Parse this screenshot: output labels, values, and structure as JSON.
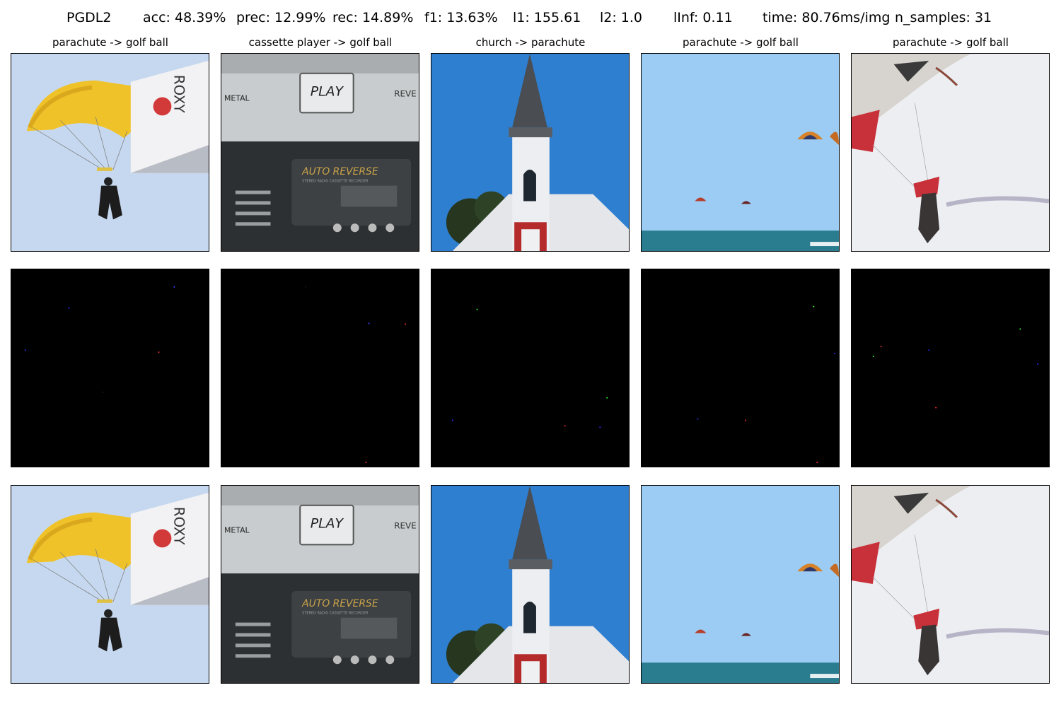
{
  "metrics": {
    "method": "PGDL2",
    "acc": "acc: 48.39%",
    "prec": "prec: 12.99%",
    "rec": "rec: 14.89%",
    "f1": "f1: 13.63%",
    "l1": "l1: 155.61",
    "l2": "l2: 1.0",
    "linf": "lInf: 0.11",
    "time": "time: 80.76ms/img",
    "n_samples": "n_samples: 31"
  },
  "columns": [
    {
      "title": "parachute -> golf ball",
      "scene": "skydiver-yellow-parachute"
    },
    {
      "title": "cassette player -> golf ball",
      "scene": "cassette-player-play-button"
    },
    {
      "title": "church -> parachute",
      "scene": "white-church-steeple"
    },
    {
      "title": "parachute -> golf ball",
      "scene": "parasails-over-sea"
    },
    {
      "title": "parachute -> golf ball",
      "scene": "skydiver-red-white-canopy"
    }
  ],
  "cassette_text": {
    "play": "PLAY",
    "metal": "METAL",
    "auto_reverse": "AUTO REVERSE",
    "recorder": "STEREO RADIO CASSETTE RECORDER",
    "reverse": "REVE"
  },
  "parachute_text": "ROXY",
  "colors": {
    "sky_pale": "#c6d8ef",
    "sky_blue": "#9cccf4",
    "church_sky": "#2f7fd0",
    "canopy_yellow": "#f0c22a",
    "sea": "#2a7c8f",
    "canopy_red": "#c8303a",
    "perturbation_bg": "#000000"
  }
}
